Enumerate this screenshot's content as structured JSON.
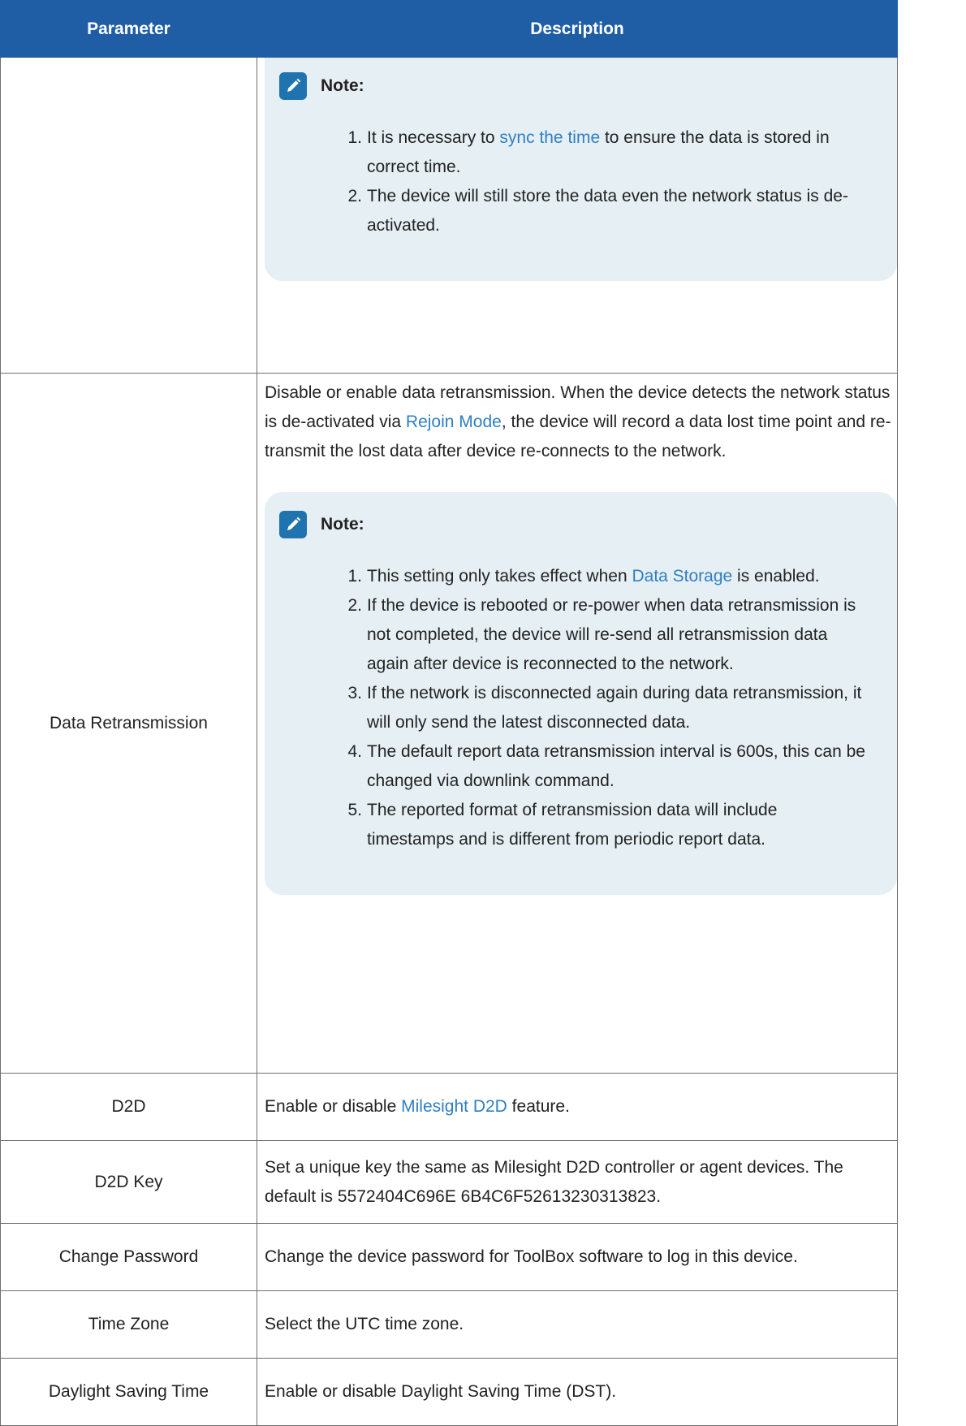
{
  "table": {
    "headers": {
      "parameter": "Parameter",
      "description": "Description"
    },
    "note_title": "Note:",
    "data_storage_note": {
      "items": [
        {
          "num": "1.",
          "pre": "It is necessary to ",
          "link": "sync the time",
          "post": " to ensure the data is stored in correct time."
        },
        {
          "num": "2.",
          "text": "The device will still store the data even the network status is de-activated."
        }
      ]
    },
    "data_retransmission": {
      "parameter": "Data Retransmission",
      "desc_pre": "Disable or enable data retransmission. When the device detects the network status is de-activated via ",
      "desc_link": "Rejoin Mode",
      "desc_post": ", the device will record a data lost time point and re-transmit the lost data after device re-connects to the network.",
      "note_items": [
        {
          "num": "1.",
          "pre": "This setting only takes effect when ",
          "link": "Data Storage",
          "post": " is enabled."
        },
        {
          "num": "2.",
          "text": "If the device is rebooted or re-power when data retransmission is not completed, the device will re-send all retransmission data again after device is reconnected to the network."
        },
        {
          "num": "3.",
          "text": "If the network is disconnected again during data retransmission, it will only send the latest disconnected data."
        },
        {
          "num": "4.",
          "text": "The default report data retransmission interval is 600s, this can be changed via downlink command."
        },
        {
          "num": "5.",
          "text": "The reported format of retransmission data will include timestamps and is different from periodic report data."
        }
      ]
    },
    "d2d": {
      "parameter": "D2D",
      "desc_pre": "Enable or disable ",
      "desc_link": "Milesight D2D",
      "desc_post": " feature."
    },
    "d2d_key": {
      "parameter": "D2D Key",
      "description": "Set a unique key the same as Milesight D2D controller or agent devices. The default is 5572404C696E 6B4C6F52613230313823."
    },
    "change_password": {
      "parameter": "Change Password",
      "description": "Change the device password for ToolBox software to log in this device."
    },
    "time_zone": {
      "parameter": "Time Zone",
      "description": "Select the UTC time zone."
    },
    "daylight_saving_time": {
      "parameter": "Daylight Saving Time",
      "description": "Enable or disable Daylight Saving Time (DST)."
    }
  },
  "colors": {
    "header_bg": "#1f5ea5",
    "note_bg": "#e6eff4",
    "link": "#2f7fc4",
    "note_icon": "#1f73ae"
  },
  "icons": {
    "note": "pencil-note-icon"
  }
}
